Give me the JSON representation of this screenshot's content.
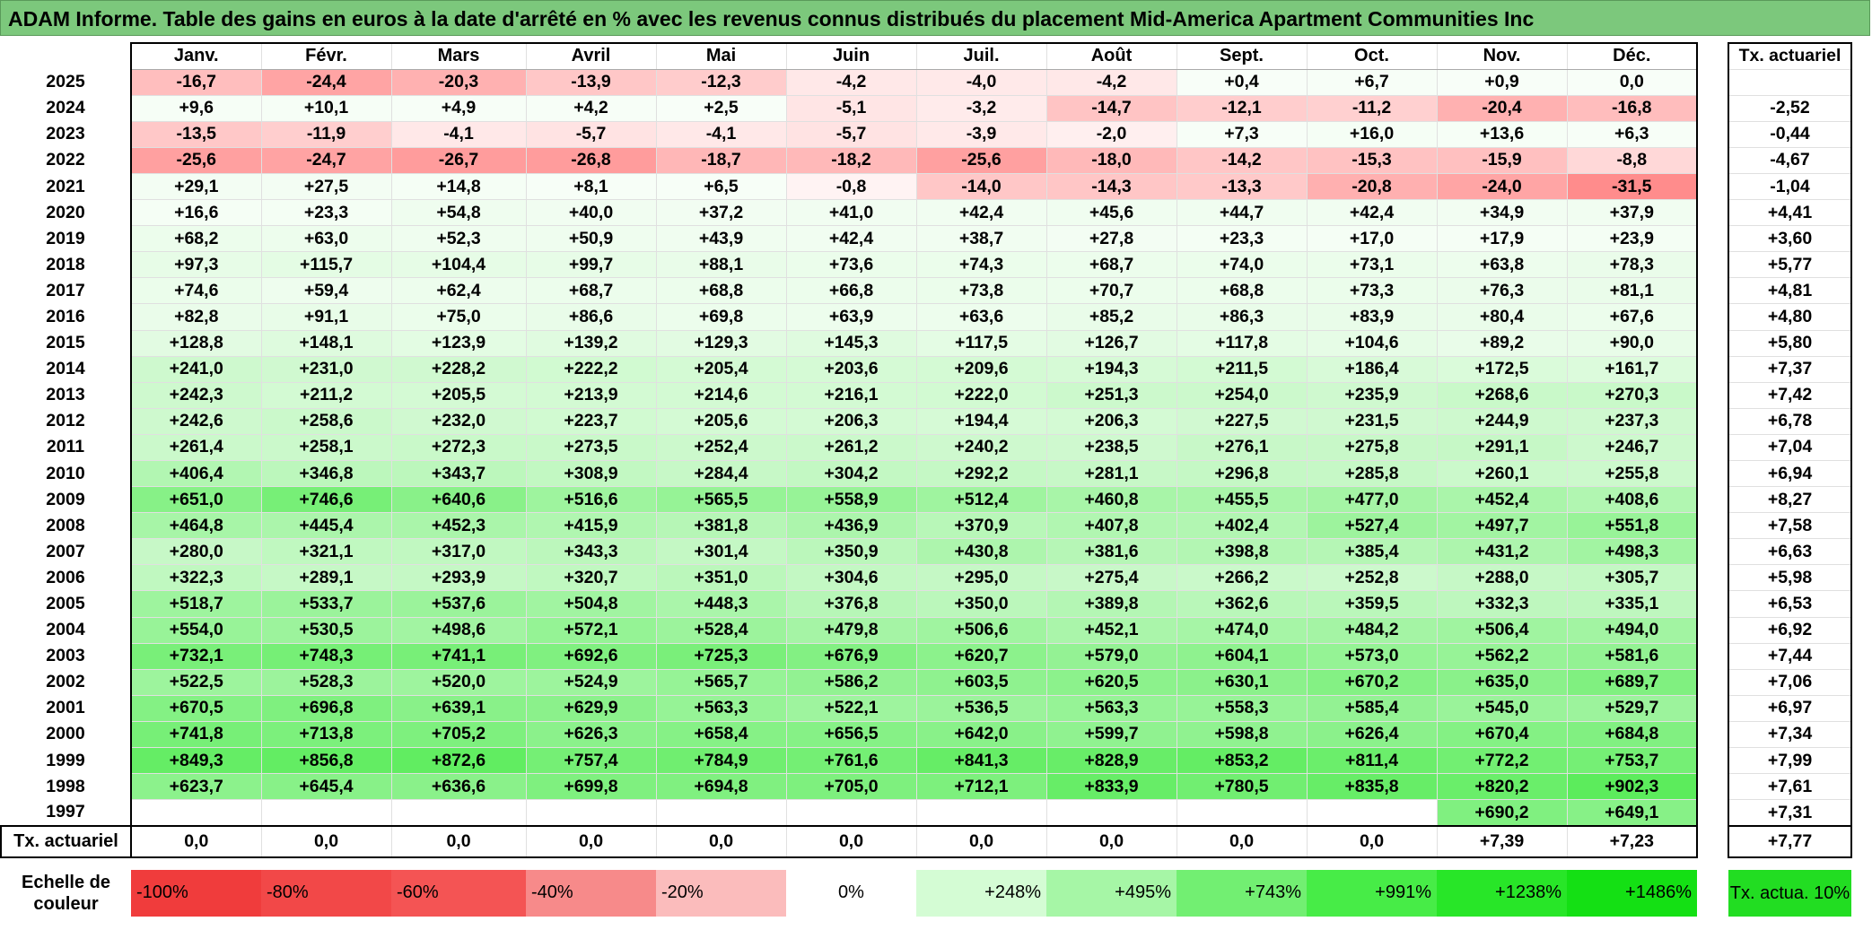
{
  "title": "ADAM Informe. Table des gains en euros à la date d'arrêté en % avec les revenus connus distribués du placement Mid-America Apartment Communities Inc",
  "months": [
    "Janv.",
    "Févr.",
    "Mars",
    "Avril",
    "Mai",
    "Juin",
    "Juil.",
    "Août",
    "Sept.",
    "Oct.",
    "Nov.",
    "Déc."
  ],
  "actuarial_header": "Tx. actuariel",
  "rows": [
    {
      "year": "2025",
      "values": [
        "-16,7",
        "-24,4",
        "-20,3",
        "-13,9",
        "-12,3",
        "-4,2",
        "-4,0",
        "-4,2",
        "+0,4",
        "+6,7",
        "+0,9",
        "0,0"
      ],
      "rate": ""
    },
    {
      "year": "2024",
      "values": [
        "+9,6",
        "+10,1",
        "+4,9",
        "+4,2",
        "+2,5",
        "-5,1",
        "-3,2",
        "-14,7",
        "-12,1",
        "-11,2",
        "-20,4",
        "-16,8"
      ],
      "rate": "-2,52"
    },
    {
      "year": "2023",
      "values": [
        "-13,5",
        "-11,9",
        "-4,1",
        "-5,7",
        "-4,1",
        "-5,7",
        "-3,9",
        "-2,0",
        "+7,3",
        "+16,0",
        "+13,6",
        "+6,3"
      ],
      "rate": "-0,44"
    },
    {
      "year": "2022",
      "values": [
        "-25,6",
        "-24,7",
        "-26,7",
        "-26,8",
        "-18,7",
        "-18,2",
        "-25,6",
        "-18,0",
        "-14,2",
        "-15,3",
        "-15,9",
        "-8,8"
      ],
      "rate": "-4,67"
    },
    {
      "year": "2021",
      "values": [
        "+29,1",
        "+27,5",
        "+14,8",
        "+8,1",
        "+6,5",
        "-0,8",
        "-14,0",
        "-14,3",
        "-13,3",
        "-20,8",
        "-24,0",
        "-31,5"
      ],
      "rate": "-1,04"
    },
    {
      "year": "2020",
      "values": [
        "+16,6",
        "+23,3",
        "+54,8",
        "+40,0",
        "+37,2",
        "+41,0",
        "+42,4",
        "+45,6",
        "+44,7",
        "+42,4",
        "+34,9",
        "+37,9"
      ],
      "rate": "+4,41"
    },
    {
      "year": "2019",
      "values": [
        "+68,2",
        "+63,0",
        "+52,3",
        "+50,9",
        "+43,9",
        "+42,4",
        "+38,7",
        "+27,8",
        "+23,3",
        "+17,0",
        "+17,9",
        "+23,9"
      ],
      "rate": "+3,60"
    },
    {
      "year": "2018",
      "values": [
        "+97,3",
        "+115,7",
        "+104,4",
        "+99,7",
        "+88,1",
        "+73,6",
        "+74,3",
        "+68,7",
        "+74,0",
        "+73,1",
        "+63,8",
        "+78,3"
      ],
      "rate": "+5,77"
    },
    {
      "year": "2017",
      "values": [
        "+74,6",
        "+59,4",
        "+62,4",
        "+68,7",
        "+68,8",
        "+66,8",
        "+73,8",
        "+70,7",
        "+68,8",
        "+73,3",
        "+76,3",
        "+81,1"
      ],
      "rate": "+4,81"
    },
    {
      "year": "2016",
      "values": [
        "+82,8",
        "+91,1",
        "+75,0",
        "+86,6",
        "+69,8",
        "+63,9",
        "+63,6",
        "+85,2",
        "+86,3",
        "+83,9",
        "+80,4",
        "+67,6"
      ],
      "rate": "+4,80"
    },
    {
      "year": "2015",
      "values": [
        "+128,8",
        "+148,1",
        "+123,9",
        "+139,2",
        "+129,3",
        "+145,3",
        "+117,5",
        "+126,7",
        "+117,8",
        "+104,6",
        "+89,2",
        "+90,0"
      ],
      "rate": "+5,80"
    },
    {
      "year": "2014",
      "values": [
        "+241,0",
        "+231,0",
        "+228,2",
        "+222,2",
        "+205,4",
        "+203,6",
        "+209,6",
        "+194,3",
        "+211,5",
        "+186,4",
        "+172,5",
        "+161,7"
      ],
      "rate": "+7,37"
    },
    {
      "year": "2013",
      "values": [
        "+242,3",
        "+211,2",
        "+205,5",
        "+213,9",
        "+214,6",
        "+216,1",
        "+222,0",
        "+251,3",
        "+254,0",
        "+235,9",
        "+268,6",
        "+270,3"
      ],
      "rate": "+7,42"
    },
    {
      "year": "2012",
      "values": [
        "+242,6",
        "+258,6",
        "+232,0",
        "+223,7",
        "+205,6",
        "+206,3",
        "+194,4",
        "+206,3",
        "+227,5",
        "+231,5",
        "+244,9",
        "+237,3"
      ],
      "rate": "+6,78"
    },
    {
      "year": "2011",
      "values": [
        "+261,4",
        "+258,1",
        "+272,3",
        "+273,5",
        "+252,4",
        "+261,2",
        "+240,2",
        "+238,5",
        "+276,1",
        "+275,8",
        "+291,1",
        "+246,7"
      ],
      "rate": "+7,04"
    },
    {
      "year": "2010",
      "values": [
        "+406,4",
        "+346,8",
        "+343,7",
        "+308,9",
        "+284,4",
        "+304,2",
        "+292,2",
        "+281,1",
        "+296,8",
        "+285,8",
        "+260,1",
        "+255,8"
      ],
      "rate": "+6,94"
    },
    {
      "year": "2009",
      "values": [
        "+651,0",
        "+746,6",
        "+640,6",
        "+516,6",
        "+565,5",
        "+558,9",
        "+512,4",
        "+460,8",
        "+455,5",
        "+477,0",
        "+452,4",
        "+408,6"
      ],
      "rate": "+8,27"
    },
    {
      "year": "2008",
      "values": [
        "+464,8",
        "+445,4",
        "+452,3",
        "+415,9",
        "+381,8",
        "+436,9",
        "+370,9",
        "+407,8",
        "+402,4",
        "+527,4",
        "+497,7",
        "+551,8"
      ],
      "rate": "+7,58"
    },
    {
      "year": "2007",
      "values": [
        "+280,0",
        "+321,1",
        "+317,0",
        "+343,3",
        "+301,4",
        "+350,9",
        "+430,8",
        "+381,6",
        "+398,8",
        "+385,4",
        "+431,2",
        "+498,3"
      ],
      "rate": "+6,63"
    },
    {
      "year": "2006",
      "values": [
        "+322,3",
        "+289,1",
        "+293,9",
        "+320,7",
        "+351,0",
        "+304,6",
        "+295,0",
        "+275,4",
        "+266,2",
        "+252,8",
        "+288,0",
        "+305,7"
      ],
      "rate": "+5,98"
    },
    {
      "year": "2005",
      "values": [
        "+518,7",
        "+533,7",
        "+537,6",
        "+504,8",
        "+448,3",
        "+376,8",
        "+350,0",
        "+389,8",
        "+362,6",
        "+359,5",
        "+332,3",
        "+335,1"
      ],
      "rate": "+6,53"
    },
    {
      "year": "2004",
      "values": [
        "+554,0",
        "+530,5",
        "+498,6",
        "+572,1",
        "+528,4",
        "+479,8",
        "+506,6",
        "+452,1",
        "+474,0",
        "+484,2",
        "+506,4",
        "+494,0"
      ],
      "rate": "+6,92"
    },
    {
      "year": "2003",
      "values": [
        "+732,1",
        "+748,3",
        "+741,1",
        "+692,6",
        "+725,3",
        "+676,9",
        "+620,7",
        "+579,0",
        "+604,1",
        "+573,0",
        "+562,2",
        "+581,6"
      ],
      "rate": "+7,44"
    },
    {
      "year": "2002",
      "values": [
        "+522,5",
        "+528,3",
        "+520,0",
        "+524,9",
        "+565,7",
        "+586,2",
        "+603,5",
        "+620,5",
        "+630,1",
        "+670,2",
        "+635,0",
        "+689,7"
      ],
      "rate": "+7,06"
    },
    {
      "year": "2001",
      "values": [
        "+670,5",
        "+696,8",
        "+639,1",
        "+629,9",
        "+563,3",
        "+522,1",
        "+536,5",
        "+563,3",
        "+558,3",
        "+585,4",
        "+545,0",
        "+529,7"
      ],
      "rate": "+6,97"
    },
    {
      "year": "2000",
      "values": [
        "+741,8",
        "+713,8",
        "+705,2",
        "+626,3",
        "+658,4",
        "+656,5",
        "+642,0",
        "+599,7",
        "+598,8",
        "+626,4",
        "+670,4",
        "+684,8"
      ],
      "rate": "+7,34"
    },
    {
      "year": "1999",
      "values": [
        "+849,3",
        "+856,8",
        "+872,6",
        "+757,4",
        "+784,9",
        "+761,6",
        "+841,3",
        "+828,9",
        "+853,2",
        "+811,4",
        "+772,2",
        "+753,7"
      ],
      "rate": "+7,99"
    },
    {
      "year": "1998",
      "values": [
        "+623,7",
        "+645,4",
        "+636,6",
        "+699,8",
        "+694,8",
        "+705,0",
        "+712,1",
        "+833,9",
        "+780,5",
        "+835,8",
        "+820,2",
        "+902,3"
      ],
      "rate": "+7,61"
    },
    {
      "year": "1997",
      "values": [
        "",
        "",
        "",
        "",
        "",
        "",
        "",
        "",
        "",
        "",
        "+690,2",
        "+649,1"
      ],
      "rate": "+7,31"
    }
  ],
  "totals": {
    "label": "Tx. actuariel",
    "values": [
      "0,0",
      "0,0",
      "0,0",
      "0,0",
      "0,0",
      "0,0",
      "0,0",
      "0,0",
      "0,0",
      "0,0",
      "+7,39",
      "+7,23"
    ],
    "rate": "+7,77"
  },
  "legend": {
    "label": "Echelle de couleur",
    "steps": [
      {
        "text": "-100%",
        "color": "#f03c3c",
        "align": "left"
      },
      {
        "text": "-80%",
        "color": "#f24848",
        "align": "left"
      },
      {
        "text": "-60%",
        "color": "#f45454",
        "align": "left"
      },
      {
        "text": "-40%",
        "color": "#f78a8a",
        "align": "left"
      },
      {
        "text": "-20%",
        "color": "#fbbcbc",
        "align": "left"
      },
      {
        "text": "0%",
        "color": "#ffffff",
        "align": "center"
      },
      {
        "text": "+248%",
        "color": "#d4fcd4",
        "align": "right"
      },
      {
        "text": "+495%",
        "color": "#a6f6a6",
        "align": "right"
      },
      {
        "text": "+743%",
        "color": "#72ef72",
        "align": "right"
      },
      {
        "text": "+991%",
        "color": "#47ec47",
        "align": "right"
      },
      {
        "text": "+1238%",
        "color": "#28e628",
        "align": "right"
      },
      {
        "text": "+1486%",
        "color": "#14e014",
        "align": "right"
      }
    ],
    "rate_label": "Tx. actua. 10%",
    "rate_color": "#22dd22"
  }
}
